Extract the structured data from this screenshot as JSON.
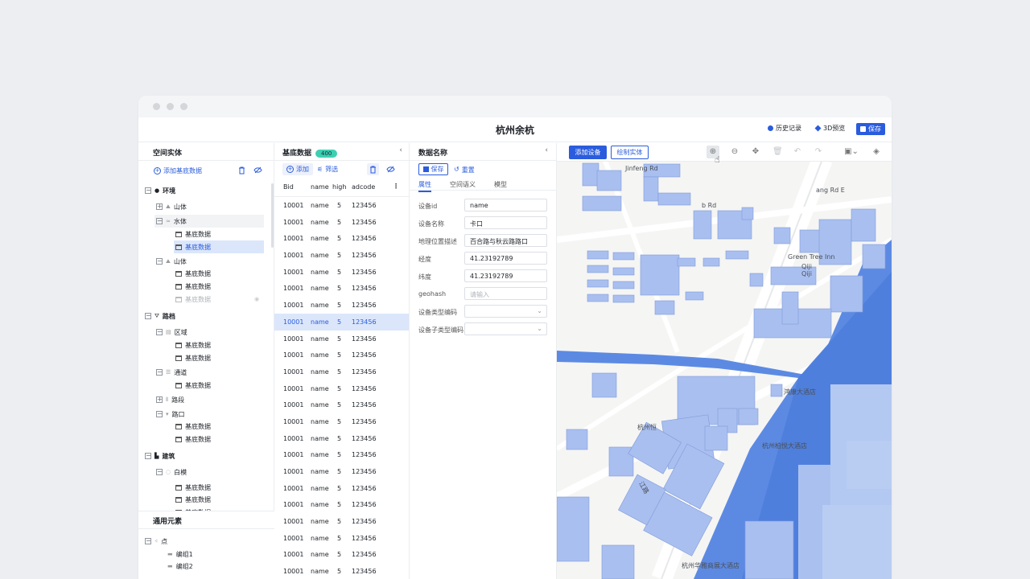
{
  "header": {
    "title": "杭州余杭",
    "history_label": "历史记录",
    "preview_label": "3D预览",
    "save_label": "保存"
  },
  "left_panel": {
    "title": "空间实体",
    "add_label": "添加基底数据",
    "tree": [
      {
        "label": "环境",
        "level": 0,
        "toggle": "−",
        "icon": "globe-icon"
      },
      {
        "label": "山体",
        "level": 1,
        "toggle": "+",
        "icon": "mountain-icon"
      },
      {
        "label": "水体",
        "level": 1,
        "toggle": "−",
        "icon": "water-icon"
      },
      {
        "label": "基底数据",
        "level": 2,
        "icon": "table-icon"
      },
      {
        "label": "基底数据",
        "level": 2,
        "icon": "table-icon",
        "selected": true
      },
      {
        "label": "山体",
        "level": 1,
        "toggle": "−",
        "icon": "hill-icon"
      },
      {
        "label": "基底数据",
        "level": 2,
        "icon": "table-icon"
      },
      {
        "label": "基底数据",
        "level": 2,
        "icon": "table-icon"
      },
      {
        "label": "基底数据",
        "level": 2,
        "icon": "table-icon",
        "dimmed": true
      },
      {
        "label": "路档",
        "level": 0,
        "toggle": "−",
        "icon": "road-icon"
      },
      {
        "label": "区域",
        "level": 1,
        "toggle": "−",
        "icon": "area-icon"
      },
      {
        "label": "基底数据",
        "level": 2,
        "icon": "table-icon"
      },
      {
        "label": "基底数据",
        "level": 2,
        "icon": "table-icon"
      },
      {
        "label": "通道",
        "level": 1,
        "toggle": "−",
        "icon": "channel-icon"
      },
      {
        "label": "基底数据",
        "level": 2,
        "icon": "table-icon"
      },
      {
        "label": "路段",
        "level": 1,
        "toggle": "+",
        "icon": "segment-icon"
      },
      {
        "label": "路口",
        "level": 1,
        "toggle": "−",
        "icon": "junction-icon"
      },
      {
        "label": "基底数据",
        "level": 2,
        "icon": "table-icon"
      },
      {
        "label": "基底数据",
        "level": 2,
        "icon": "table-icon"
      },
      {
        "label": "建筑",
        "level": 0,
        "toggle": "−",
        "icon": "building-icon"
      },
      {
        "label": "白模",
        "level": 1,
        "toggle": "−",
        "icon": "model-icon"
      },
      {
        "label": "基底数据",
        "level": 2,
        "icon": "table-icon"
      },
      {
        "label": "基底数据",
        "level": 2,
        "icon": "table-icon"
      },
      {
        "label": "基底数据",
        "level": 2,
        "icon": "table-icon"
      }
    ],
    "common_title": "通用元素",
    "common_tree": [
      {
        "label": "点",
        "level": 0,
        "toggle": "−"
      },
      {
        "label": "编组1",
        "level": 1
      },
      {
        "label": "编组2",
        "level": 1
      }
    ]
  },
  "mid_panel": {
    "title": "基底数据",
    "count": "400",
    "add_label": "添加",
    "filter_label": "筛选",
    "columns": [
      "Bid",
      "name",
      "high",
      "adcode"
    ],
    "rows": [
      [
        "10001",
        "name",
        "5",
        "123456"
      ],
      [
        "10001",
        "name",
        "5",
        "123456"
      ],
      [
        "10001",
        "name",
        "5",
        "123456"
      ],
      [
        "10001",
        "name",
        "5",
        "123456"
      ],
      [
        "10001",
        "name",
        "5",
        "123456"
      ],
      [
        "10001",
        "name",
        "5",
        "123456"
      ],
      [
        "10001",
        "name",
        "5",
        "123456"
      ],
      [
        "10001",
        "name",
        "5",
        "123456"
      ],
      [
        "10001",
        "name",
        "5",
        "123456"
      ],
      [
        "10001",
        "name",
        "5",
        "123456"
      ],
      [
        "10001",
        "name",
        "5",
        "123456"
      ],
      [
        "10001",
        "name",
        "5",
        "123456"
      ],
      [
        "10001",
        "name",
        "5",
        "123456"
      ],
      [
        "10001",
        "name",
        "5",
        "123456"
      ],
      [
        "10001",
        "name",
        "5",
        "123456"
      ],
      [
        "10001",
        "name",
        "5",
        "123456"
      ],
      [
        "10001",
        "name",
        "5",
        "123456"
      ],
      [
        "10001",
        "name",
        "5",
        "123456"
      ],
      [
        "10001",
        "name",
        "5",
        "123456"
      ],
      [
        "10001",
        "name",
        "5",
        "123456"
      ],
      [
        "10001",
        "name",
        "5",
        "123456"
      ],
      [
        "10001",
        "name",
        "5",
        "123456"
      ],
      [
        "10001",
        "name",
        "5",
        "123456"
      ],
      [
        "10001",
        "name",
        "5",
        "123456"
      ]
    ],
    "selected_row": 7
  },
  "detail_panel": {
    "title": "数据名称",
    "save_label": "保存",
    "reset_label": "重置",
    "tabs": [
      "属性",
      "空间语义",
      "模型"
    ],
    "fields": [
      {
        "label": "设备id",
        "value": "name",
        "placeholder": false
      },
      {
        "label": "设备名称",
        "value": "卡口",
        "placeholder": false
      },
      {
        "label": "地理位置描述",
        "value": "百合路与秋云路路口",
        "placeholder": false
      },
      {
        "label": "经度",
        "value": "41.23192789",
        "placeholder": false
      },
      {
        "label": "纬度",
        "value": "41.23192789",
        "placeholder": false
      },
      {
        "label": "geohash",
        "value": "请输入",
        "placeholder": true
      },
      {
        "label": "设备类型编码",
        "value": "",
        "select": true
      },
      {
        "label": "设备子类型编码",
        "value": "",
        "select": true
      }
    ]
  },
  "map": {
    "add_device_label": "添加设备",
    "draw_entity_label": "绘制实体",
    "labels": [
      "Jinfeng Rd",
      "ang Rd E",
      "Green Tree Inn",
      "Qiji",
      "鸿康大酒店",
      "杭州柏悦大酒店",
      "杭州华雅商展大酒店",
      "杭州恒",
      "江路",
      "b Rd",
      "Qiji"
    ]
  }
}
